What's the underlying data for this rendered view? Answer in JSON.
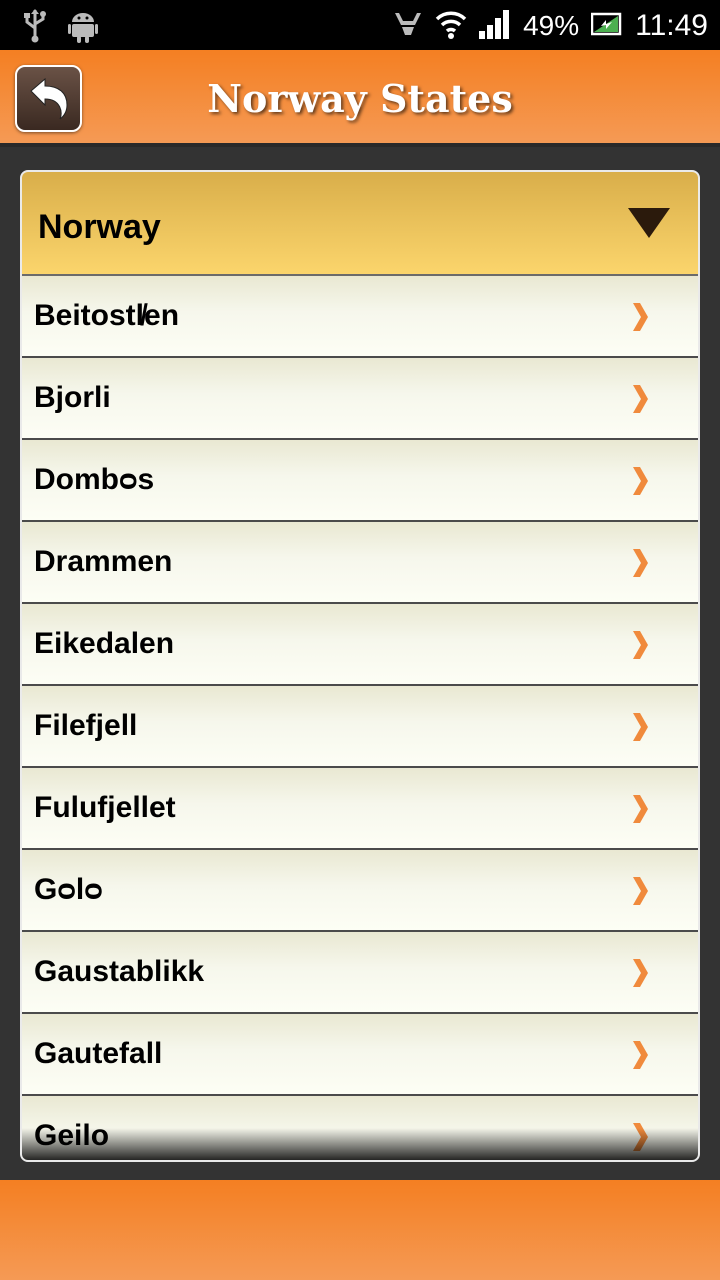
{
  "status_bar": {
    "battery_percent": "49%",
    "time": "11:49",
    "icons": [
      "usb-icon",
      "android-debug-icon",
      "signal-booster-icon",
      "wifi-icon",
      "cell-signal-icon",
      "battery-charging-icon"
    ]
  },
  "header": {
    "title": "Norway States",
    "back_icon": "back-arrow-icon"
  },
  "group": {
    "title": "Norway",
    "expand_icon": "triangle-down-icon"
  },
  "items": [
    {
      "label": "Beitostl̸en"
    },
    {
      "label": "Bjorli"
    },
    {
      "label": "Dombᴑs"
    },
    {
      "label": "Drammen"
    },
    {
      "label": "Eikedalen"
    },
    {
      "label": "Filefjell"
    },
    {
      "label": "Fulufjellet"
    },
    {
      "label": "Gᴑlᴑ"
    },
    {
      "label": "Gaustablikk"
    },
    {
      "label": "Gautefall"
    },
    {
      "label": "Geilo"
    }
  ],
  "colors": {
    "header_orange": "#f47f22",
    "group_gold": "#fbd56c",
    "chevron_orange": "#f08a3c"
  }
}
